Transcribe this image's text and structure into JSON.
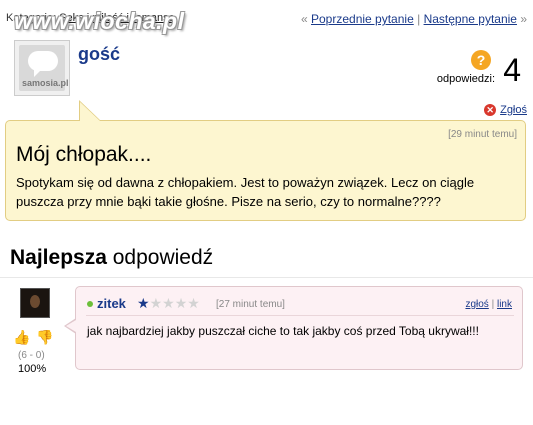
{
  "header": {
    "category_label": "Kategoria:",
    "category_link": "Seks i miłość i romanse",
    "watermark": "www.wiocha.pl",
    "prev_question": "Poprzednie pytanie",
    "next_question": "Następne pytanie",
    "nav_separator": "|",
    "nav_left_arrow": "«",
    "nav_right_arrow": "»"
  },
  "question": {
    "avatar_text": "samosia.pl",
    "author": "gość",
    "answers_badge": "?",
    "answers_label": "odpowiedzi:",
    "answers_count": "4",
    "report_label": "Zgłoś",
    "time": "[29 minut temu]",
    "title": "Mój chłopak....",
    "body": "Spotykam się od dawna z chłopakiem. Jest to poważyn związek. Lecz on ciągle puszcza przy mnie bąki takie głośne. Pisze na serio, czy to normalne????"
  },
  "best_answer": {
    "heading_bold": "Najlepsza",
    "heading_rest": " odpowiedź",
    "user": "zitek",
    "rating_stars": 1,
    "rating_max": 5,
    "time": "[27 minut temu]",
    "report_link": "zgłoś",
    "link_label": "link",
    "link_separator": "|",
    "body": "jak najbardziej jakby puszczał ciche to tak jakby coś przed Tobą ukrywał!!!",
    "votes_text": "(6 - 0)",
    "approval": "100%",
    "colors": {
      "online": "#6cbf3a",
      "star": "#1a3a8a",
      "thumb_up": "#c45ac9",
      "thumb_down": "#e6a417"
    }
  },
  "icons": {
    "answers_icon": "question-badge-icon",
    "report_icon": "report-x-icon",
    "thumb_up": "thumb-up-icon",
    "thumb_down": "thumb-down-icon"
  }
}
